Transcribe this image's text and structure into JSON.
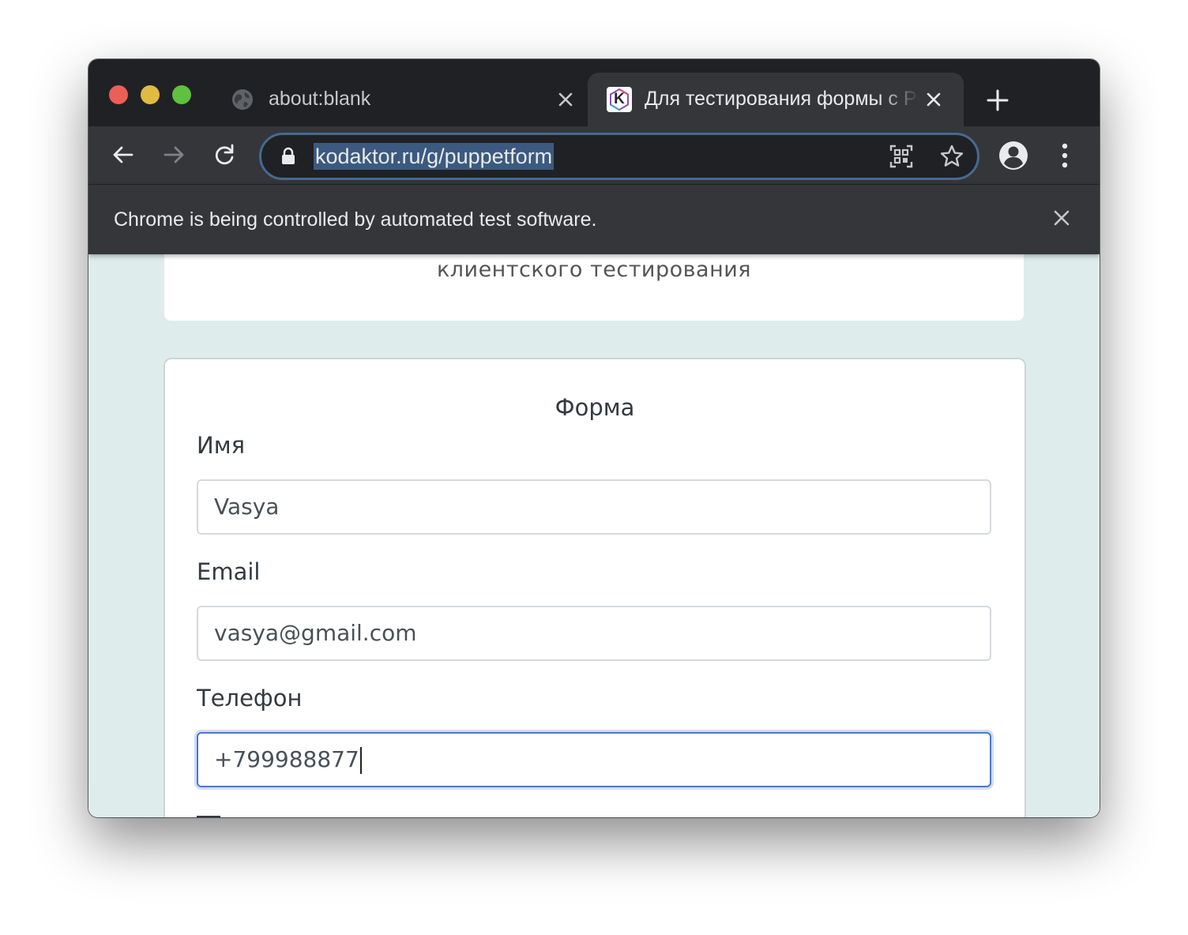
{
  "browser": {
    "tabs": [
      {
        "title": "about:blank",
        "active": false,
        "icon": "globe-icon"
      },
      {
        "title": "Для тестирования формы с Puppeteer",
        "active": true,
        "icon": "kodaktor-favicon",
        "favicon_letter": "K"
      }
    ],
    "url": "kodaktor.ru/g/puppetform",
    "infobar": {
      "text": "Chrome is being controlled by automated test software."
    }
  },
  "page": {
    "header_fragment": "клиентского тестирования",
    "form": {
      "title": "Форма",
      "fields": [
        {
          "label": "Имя",
          "value": "Vasya"
        },
        {
          "label": "Email",
          "value": "vasya@gmail.com"
        },
        {
          "label": "Телефон",
          "value": "+799988877",
          "focused": true
        }
      ]
    }
  },
  "colors": {
    "titlebar": "#202124",
    "toolbar": "#35363a",
    "url_selection": "#3c5a7f",
    "page_background": "#deecec",
    "focus_border": "#4a77d4"
  }
}
